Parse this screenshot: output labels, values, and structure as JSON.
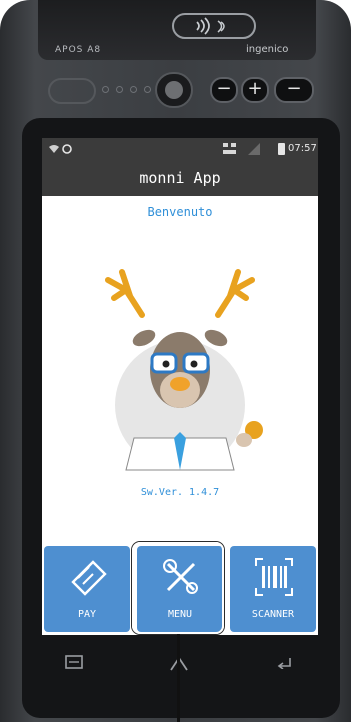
{
  "device": {
    "model_label": "APOS A8",
    "brand_label": "ingenico"
  },
  "status_bar": {
    "time": "07:57"
  },
  "app": {
    "title": "monni App",
    "welcome_text": "Benvenuto",
    "version_text": "Sw.Ver. 1.4.7"
  },
  "tiles": [
    {
      "label": "PAY",
      "icon": "card-pay-icon"
    },
    {
      "label": "MENU",
      "icon": "tools-icon"
    },
    {
      "label": "SCANNER",
      "icon": "barcode-scanner-icon"
    }
  ],
  "nav": {
    "icons": [
      "recent-apps-icon",
      "home-icon",
      "back-icon"
    ]
  },
  "colors": {
    "tile_blue": "#4e8fd0",
    "title_blue": "#2f8fd8",
    "appbar": "#3b3b3b"
  }
}
